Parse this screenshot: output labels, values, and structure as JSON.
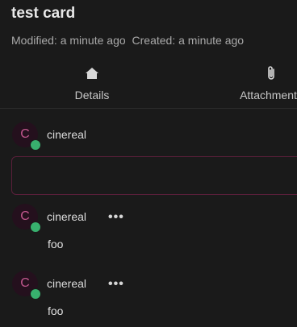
{
  "card": {
    "title": "test card",
    "modified": "Modified: a minute ago",
    "created": "Created: a minute ago"
  },
  "tabs": [
    {
      "label": "Details",
      "icon": "home-icon"
    },
    {
      "label": "Attachments",
      "icon": "paperclip-icon"
    }
  ],
  "composer": {
    "avatar_initial": "C",
    "username": "cinereal",
    "input_value": "",
    "input_placeholder": ""
  },
  "comments": [
    {
      "avatar_initial": "C",
      "username": "cinereal",
      "more_label": "•••",
      "body": "foo"
    },
    {
      "avatar_initial": "C",
      "username": "cinereal",
      "more_label": "•••",
      "body": "foo"
    }
  ],
  "colors": {
    "background": "#1a1a1a",
    "avatar_bg": "#24101d",
    "avatar_text": "#c0578d",
    "presence_online": "#38b06e",
    "input_border": "#5a1f3a"
  }
}
